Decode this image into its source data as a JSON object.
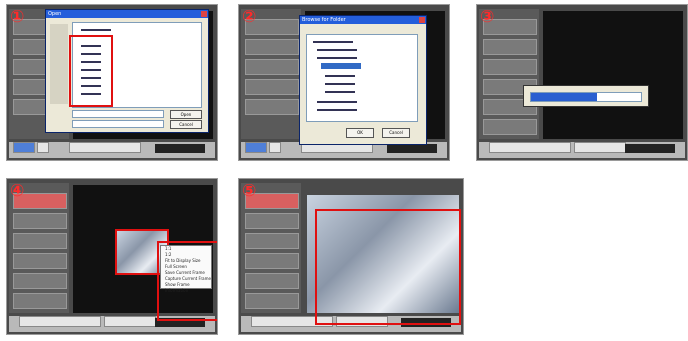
{
  "steps": [
    {
      "num": "①",
      "dialog_title": "Open",
      "list_items": [
        "Look in",
        "file 1",
        "file 2",
        "file 3",
        "file 4",
        "file 5",
        "file 6",
        "file 7"
      ],
      "buttons": [
        "Open",
        "Cancel"
      ],
      "field_labels": [
        "File name:",
        "Files of type:"
      ]
    },
    {
      "num": "②",
      "dialog_title": "Browse for Folder",
      "buttons": [
        "OK",
        "Cancel"
      ]
    },
    {
      "num": "③",
      "progress_value": 0.6
    },
    {
      "num": "④",
      "menu_items": [
        "1:1",
        "1:2",
        "Fit to Display Size",
        "Full Screen",
        "Save Current Frame",
        "Capture Current Frame",
        "Show Frame Information"
      ]
    },
    {
      "num": "⑤"
    }
  ],
  "colors": {
    "accent": "#e01010",
    "dialog_title": "#245edb"
  }
}
